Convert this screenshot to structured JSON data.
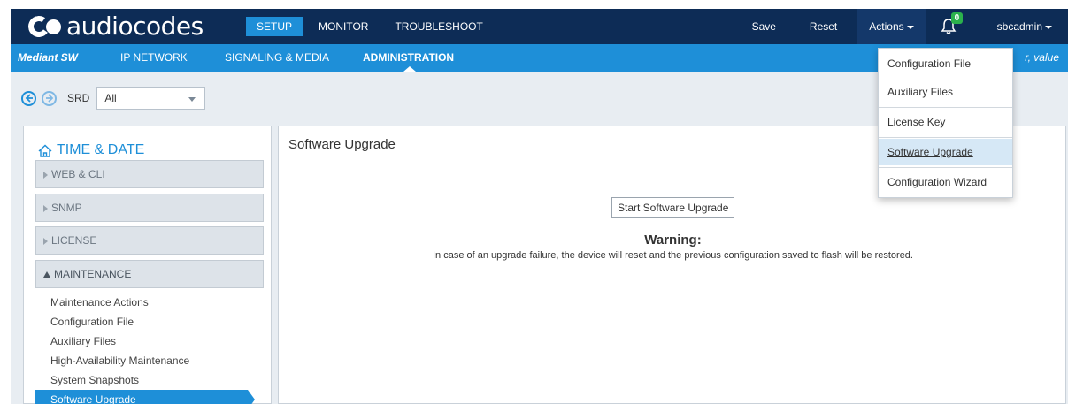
{
  "brand": {
    "logo_text": "audiocodes"
  },
  "top_nav": {
    "tabs": [
      {
        "label": "SETUP",
        "active": true
      },
      {
        "label": "MONITOR",
        "active": false
      },
      {
        "label": "TROUBLESHOOT",
        "active": false
      }
    ],
    "save_label": "Save",
    "reset_label": "Reset",
    "actions_label": "Actions",
    "notification_count": "0",
    "user_label": "sbcadmin"
  },
  "sub_nav": {
    "product": "Mediant SW",
    "items": [
      {
        "label": "IP NETWORK",
        "active": false
      },
      {
        "label": "SIGNALING & MEDIA",
        "active": false
      },
      {
        "label": "ADMINISTRATION",
        "active": true
      }
    ],
    "search_hint": "r, value"
  },
  "srd": {
    "label": "SRD",
    "selected": "All"
  },
  "sidebar": {
    "title": "TIME & DATE",
    "sections": [
      {
        "label": "WEB & CLI",
        "expanded": false
      },
      {
        "label": "SNMP",
        "expanded": false
      },
      {
        "label": "LICENSE",
        "expanded": false
      },
      {
        "label": "MAINTENANCE",
        "expanded": true
      }
    ],
    "maintenance_items": [
      {
        "label": "Maintenance Actions",
        "active": false
      },
      {
        "label": "Configuration File",
        "active": false
      },
      {
        "label": "Auxiliary Files",
        "active": false
      },
      {
        "label": "High-Availability Maintenance",
        "active": false
      },
      {
        "label": "System Snapshots",
        "active": false
      },
      {
        "label": "Software Upgrade",
        "active": true
      }
    ]
  },
  "main": {
    "title": "Software Upgrade",
    "start_button": "Start Software Upgrade",
    "warning_title": "Warning:",
    "warning_text": "In case of an upgrade failure, the device will reset and the previous configuration saved to flash will be restored."
  },
  "actions_menu": {
    "items": [
      {
        "label": "Configuration File",
        "highlighted": false
      },
      {
        "label": "Auxiliary Files",
        "highlighted": false
      },
      {
        "label": "License Key",
        "highlighted": false
      },
      {
        "label": "Software Upgrade",
        "highlighted": true
      },
      {
        "label": "Configuration Wizard",
        "highlighted": false
      }
    ]
  },
  "colors": {
    "top_bar": "#0d2c56",
    "accent_blue": "#1e8fd8",
    "badge_green": "#2bb24c",
    "content_bg": "#e8edf2"
  }
}
